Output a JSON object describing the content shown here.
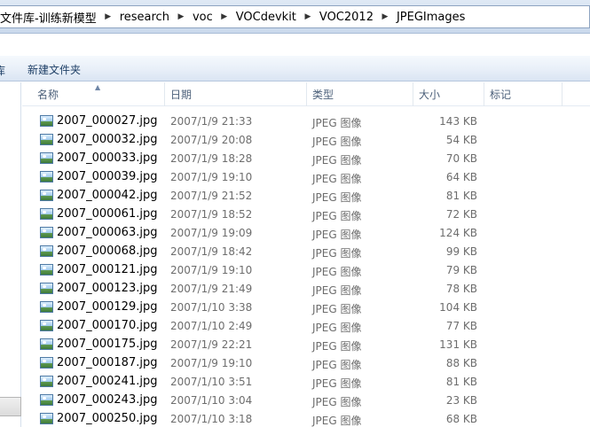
{
  "address": {
    "crumbs": [
      "文件库-训练新模型",
      "research",
      "voc",
      "VOCdevkit",
      "VOC2012",
      "JPEGImages"
    ]
  },
  "commandbar": {
    "left_edge": "库",
    "new_folder": "新建文件夹"
  },
  "columns": {
    "name": "名称",
    "date": "日期",
    "type": "类型",
    "size": "大小",
    "tags": "标记"
  },
  "files": [
    {
      "name": "2007_000027.jpg",
      "date": "2007/1/9 21:33",
      "type": "JPEG 图像",
      "size": "143 KB"
    },
    {
      "name": "2007_000032.jpg",
      "date": "2007/1/9 20:08",
      "type": "JPEG 图像",
      "size": "54 KB"
    },
    {
      "name": "2007_000033.jpg",
      "date": "2007/1/9 18:28",
      "type": "JPEG 图像",
      "size": "70 KB"
    },
    {
      "name": "2007_000039.jpg",
      "date": "2007/1/9 19:10",
      "type": "JPEG 图像",
      "size": "64 KB"
    },
    {
      "name": "2007_000042.jpg",
      "date": "2007/1/9 21:52",
      "type": "JPEG 图像",
      "size": "81 KB"
    },
    {
      "name": "2007_000061.jpg",
      "date": "2007/1/9 18:52",
      "type": "JPEG 图像",
      "size": "72 KB"
    },
    {
      "name": "2007_000063.jpg",
      "date": "2007/1/9 19:09",
      "type": "JPEG 图像",
      "size": "124 KB"
    },
    {
      "name": "2007_000068.jpg",
      "date": "2007/1/9 18:42",
      "type": "JPEG 图像",
      "size": "99 KB"
    },
    {
      "name": "2007_000121.jpg",
      "date": "2007/1/9 19:10",
      "type": "JPEG 图像",
      "size": "79 KB"
    },
    {
      "name": "2007_000123.jpg",
      "date": "2007/1/9 21:49",
      "type": "JPEG 图像",
      "size": "78 KB"
    },
    {
      "name": "2007_000129.jpg",
      "date": "2007/1/10 3:38",
      "type": "JPEG 图像",
      "size": "104 KB"
    },
    {
      "name": "2007_000170.jpg",
      "date": "2007/1/10 2:49",
      "type": "JPEG 图像",
      "size": "77 KB"
    },
    {
      "name": "2007_000175.jpg",
      "date": "2007/1/9 22:21",
      "type": "JPEG 图像",
      "size": "131 KB"
    },
    {
      "name": "2007_000187.jpg",
      "date": "2007/1/9 19:10",
      "type": "JPEG 图像",
      "size": "88 KB"
    },
    {
      "name": "2007_000241.jpg",
      "date": "2007/1/10 3:51",
      "type": "JPEG 图像",
      "size": "81 KB"
    },
    {
      "name": "2007_000243.jpg",
      "date": "2007/1/10 3:04",
      "type": "JPEG 图像",
      "size": "23 KB"
    },
    {
      "name": "2007_000250.jpg",
      "date": "2007/1/10 3:18",
      "type": "JPEG 图像",
      "size": "68 KB"
    }
  ],
  "icons": {
    "breadcrumb_separator": "chevron-right-icon",
    "sort_indicator": "sort-ascending-icon",
    "file": "image-file-icon"
  }
}
